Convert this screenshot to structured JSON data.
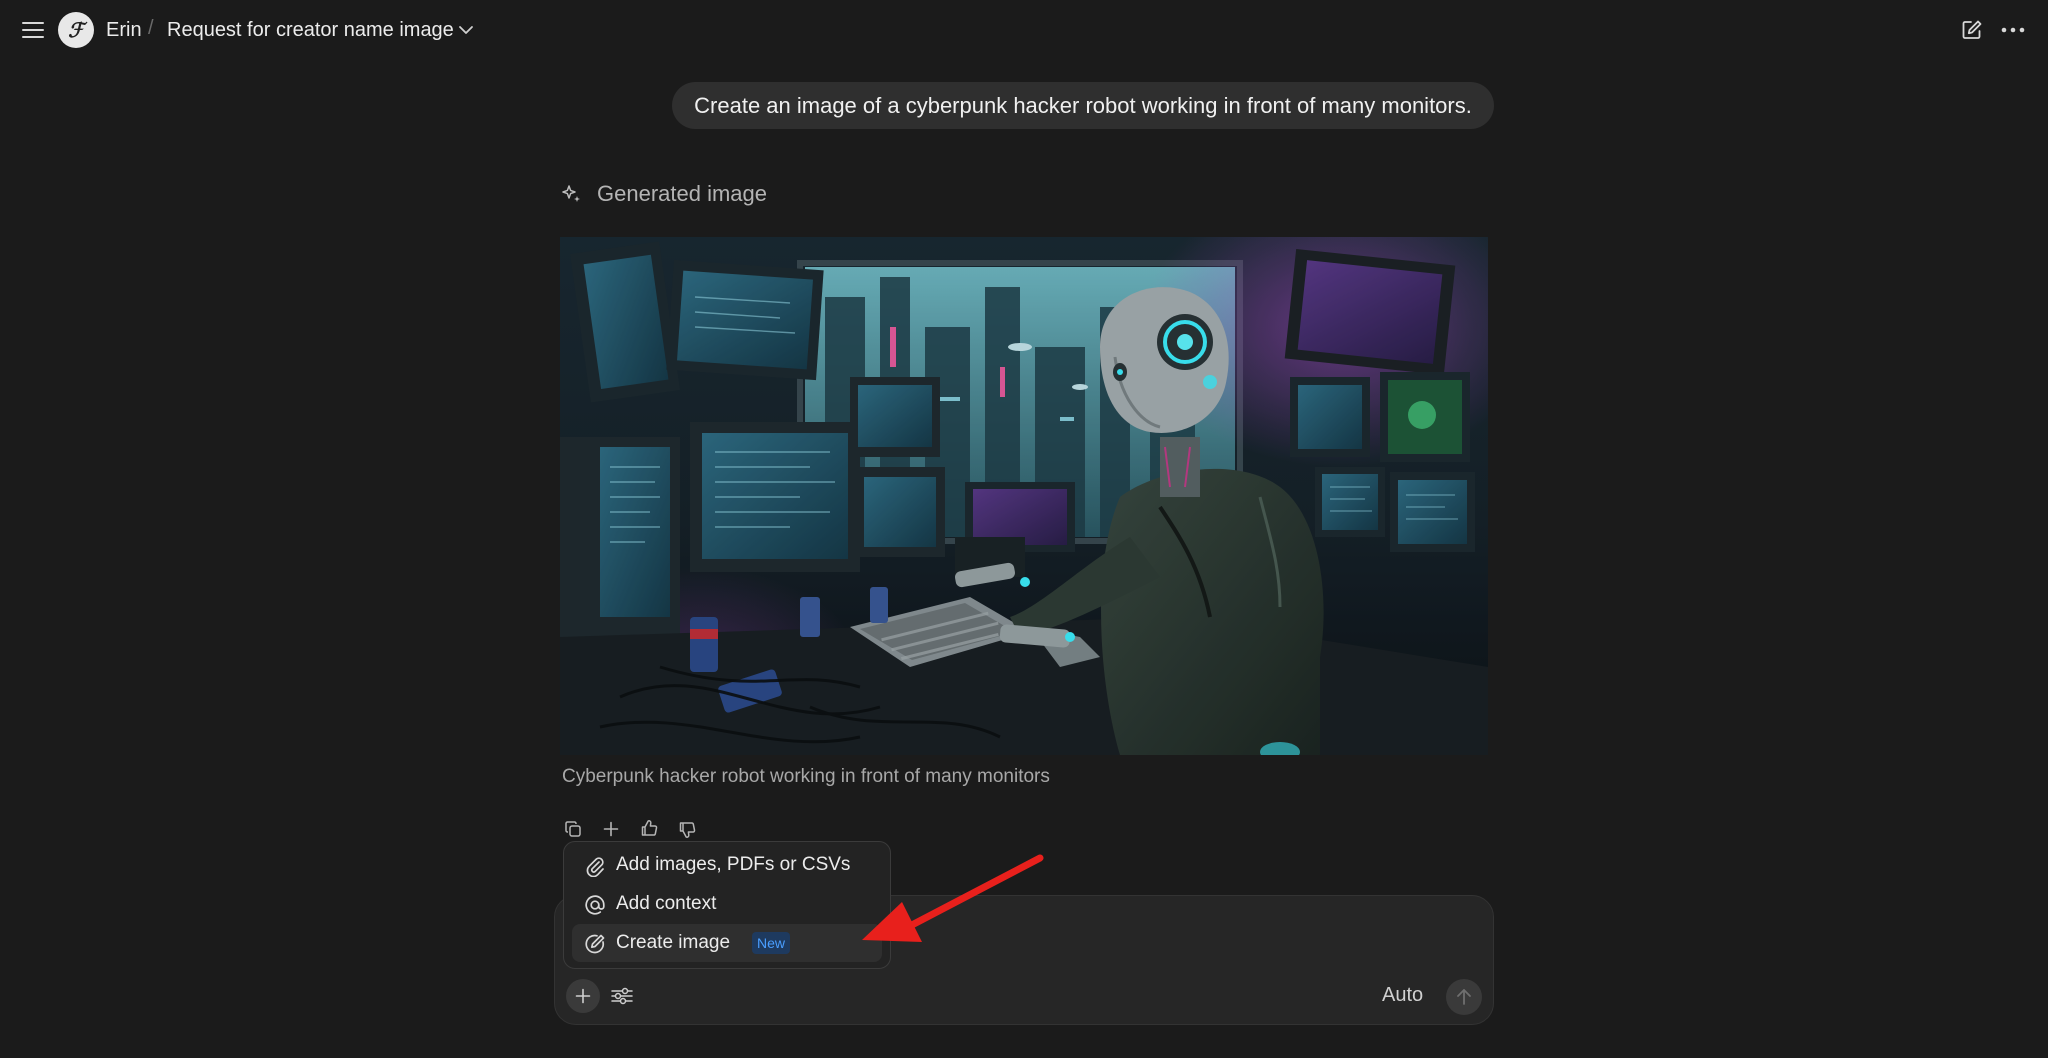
{
  "header": {
    "user_name": "Erin",
    "separator": "/",
    "chat_title": "Request for creator name image",
    "avatar_glyph": "ℱ",
    "icons": [
      "hamburger-menu-icon",
      "chevron-down-icon",
      "new-chat-icon",
      "more-options-icon"
    ]
  },
  "conversation": {
    "user_message": "Create an image of a cyberpunk hacker robot working in front of many monitors.",
    "generated_label": "Generated image",
    "image_caption": "Cyberpunk hacker robot working in front of many monitors",
    "message_actions": [
      "copy-icon",
      "plus-icon",
      "thumbs-up-icon",
      "thumbs-down-icon"
    ]
  },
  "composer_menu": {
    "items": [
      {
        "label": "Add images, PDFs or CSVs",
        "icon": "paperclip-icon"
      },
      {
        "label": "Add context",
        "icon": "at-sign-icon"
      },
      {
        "label": "Create image",
        "icon": "create-image-icon",
        "badge": "New",
        "highlighted": true
      }
    ]
  },
  "composer": {
    "model_label": "Auto",
    "icons": [
      "plus-icon",
      "settings-sliders-icon",
      "send-arrow-icon"
    ]
  },
  "colors": {
    "background": "#1b1b1b",
    "bubble": "#2f2f2f",
    "badge_text": "#4a9eff",
    "annotation_arrow": "#e8201c"
  }
}
